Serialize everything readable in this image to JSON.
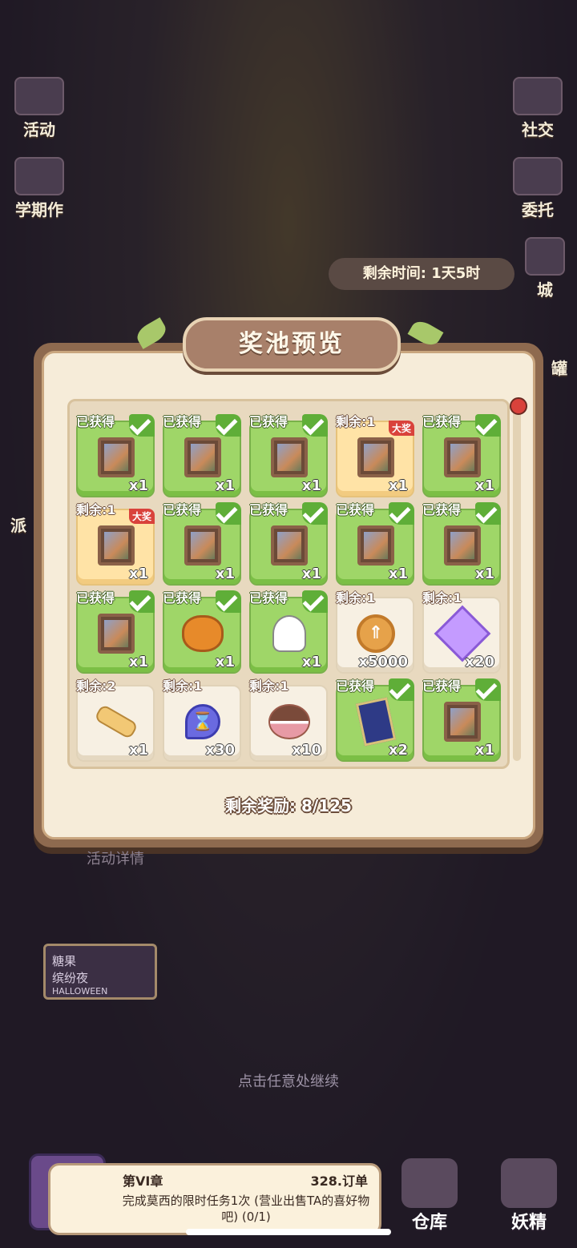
{
  "background": {
    "left_buttons": [
      {
        "label": "活动",
        "icon": "calendar-icon"
      },
      {
        "label": "学期作",
        "icon": "homework-icon"
      },
      {
        "label": "派",
        "icon": "dispatch-icon"
      }
    ],
    "right_buttons": [
      {
        "label": "社交",
        "icon": "social-icon"
      },
      {
        "label": "委托",
        "icon": "commission-icon"
      },
      {
        "label": "城",
        "icon": "city-icon"
      },
      {
        "label": "罐",
        "icon": "jar-icon"
      }
    ],
    "time_remaining": "剩余时间: 1天5时",
    "event_detail": "活动详情",
    "event_logo": [
      "糖果",
      "缤纷夜",
      "HALLOWEEN"
    ]
  },
  "dialog": {
    "title": "奖池预览",
    "remaining_rewards": "剩余奖励: 8/125",
    "items": [
      {
        "status": "已获得",
        "qty": "x1",
        "art": "frame",
        "state": "got"
      },
      {
        "status": "已获得",
        "qty": "x1",
        "art": "frame",
        "state": "got"
      },
      {
        "status": "已获得",
        "qty": "x1",
        "art": "frame",
        "state": "got"
      },
      {
        "status": "剩余:1",
        "qty": "x1",
        "art": "frame",
        "state": "gold",
        "badge": "大奖"
      },
      {
        "status": "已获得",
        "qty": "x1",
        "art": "frame",
        "state": "got"
      },
      {
        "status": "剩余:1",
        "qty": "x1",
        "art": "frame",
        "state": "gold",
        "badge": "大奖"
      },
      {
        "status": "已获得",
        "qty": "x1",
        "art": "frame",
        "state": "got"
      },
      {
        "status": "已获得",
        "qty": "x1",
        "art": "frame",
        "state": "got"
      },
      {
        "status": "已获得",
        "qty": "x1",
        "art": "frame",
        "state": "got"
      },
      {
        "status": "已获得",
        "qty": "x1",
        "art": "frame",
        "state": "got"
      },
      {
        "status": "已获得",
        "qty": "x1",
        "art": "frame",
        "state": "got"
      },
      {
        "status": "已获得",
        "qty": "x1",
        "art": "pumpkin",
        "state": "got"
      },
      {
        "status": "已获得",
        "qty": "x1",
        "art": "ghost",
        "state": "got"
      },
      {
        "status": "剩余:1",
        "qty": "x5000",
        "art": "coin",
        "state": "plain"
      },
      {
        "status": "剩余:1",
        "qty": "x20",
        "art": "gem",
        "state": "plain"
      },
      {
        "status": "剩余:2",
        "qty": "x1",
        "art": "key",
        "state": "plain"
      },
      {
        "status": "剩余:1",
        "qty": "x30",
        "art": "hourglass",
        "state": "plain"
      },
      {
        "status": "剩余:1",
        "qty": "x10",
        "art": "macaron",
        "state": "plain"
      },
      {
        "status": "已获得",
        "qty": "x2",
        "art": "ticket",
        "state": "got"
      },
      {
        "status": "已获得",
        "qty": "x1",
        "art": "frame",
        "state": "got"
      }
    ]
  },
  "continue_hint": "点击任意处继续",
  "quest": {
    "chapter": "第VI章",
    "orders": "328.订单",
    "task": "完成莫西的限时任务1次 (营业出售TA的喜好物吧) (0/1)"
  },
  "bottom_nav": [
    {
      "label": "仓库",
      "icon": "warehouse-icon"
    },
    {
      "label": "妖精",
      "icon": "fairy-icon"
    }
  ]
}
